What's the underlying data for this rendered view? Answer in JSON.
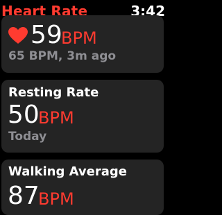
{
  "status_bar": {
    "app_title": "Heart Rate",
    "time": "3:42"
  },
  "current": {
    "value": "59",
    "unit": "BPM",
    "detail": "65 BPM, 3m ago",
    "icon": "heart-icon"
  },
  "resting": {
    "label": "Resting Rate",
    "value": "50",
    "unit": "BPM",
    "detail": "Today"
  },
  "walking": {
    "label": "Walking Average",
    "value": "87",
    "unit": "BPM"
  },
  "colors": {
    "accent": "#ff3b30",
    "card_background": "#242424",
    "secondary_text": "#8e8e93",
    "background": "#000000"
  }
}
